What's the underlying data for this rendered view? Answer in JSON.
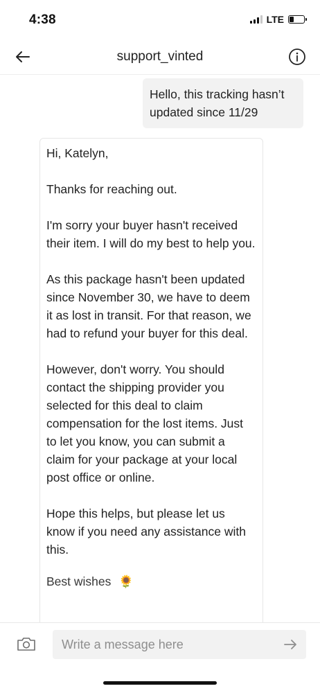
{
  "status_bar": {
    "time": "4:38",
    "network": "LTE"
  },
  "nav": {
    "title": "support_vinted",
    "back_icon": "arrow-left-icon",
    "info_icon": "info-circle-icon"
  },
  "messages": {
    "outgoing": {
      "text": "Hello, this tracking hasn’t updated since 11/29"
    },
    "incoming": {
      "paragraphs": [
        "Hi, Katelyn,",
        "Thanks for reaching out.",
        "I'm sorry your buyer hasn't received their item. I will do my best to help you.",
        "As this package hasn't been updated since November 30, we have to deem it as lost in transit. For that reason, we had to refund your buyer for this deal.",
        "However, don't worry. You should contact the shipping provider you selected for this deal to claim compensation for the lost items. Just to let you know, you can submit a claim for your package at your local post office or online.",
        "Hope this helps, but please let us know if you need any assistance with this."
      ],
      "sign_off": "Best wishes",
      "sign_off_emoji": "🌻"
    }
  },
  "composer": {
    "placeholder": "Write a message here",
    "camera_icon": "camera-icon",
    "send_icon": "arrow-right-icon"
  }
}
